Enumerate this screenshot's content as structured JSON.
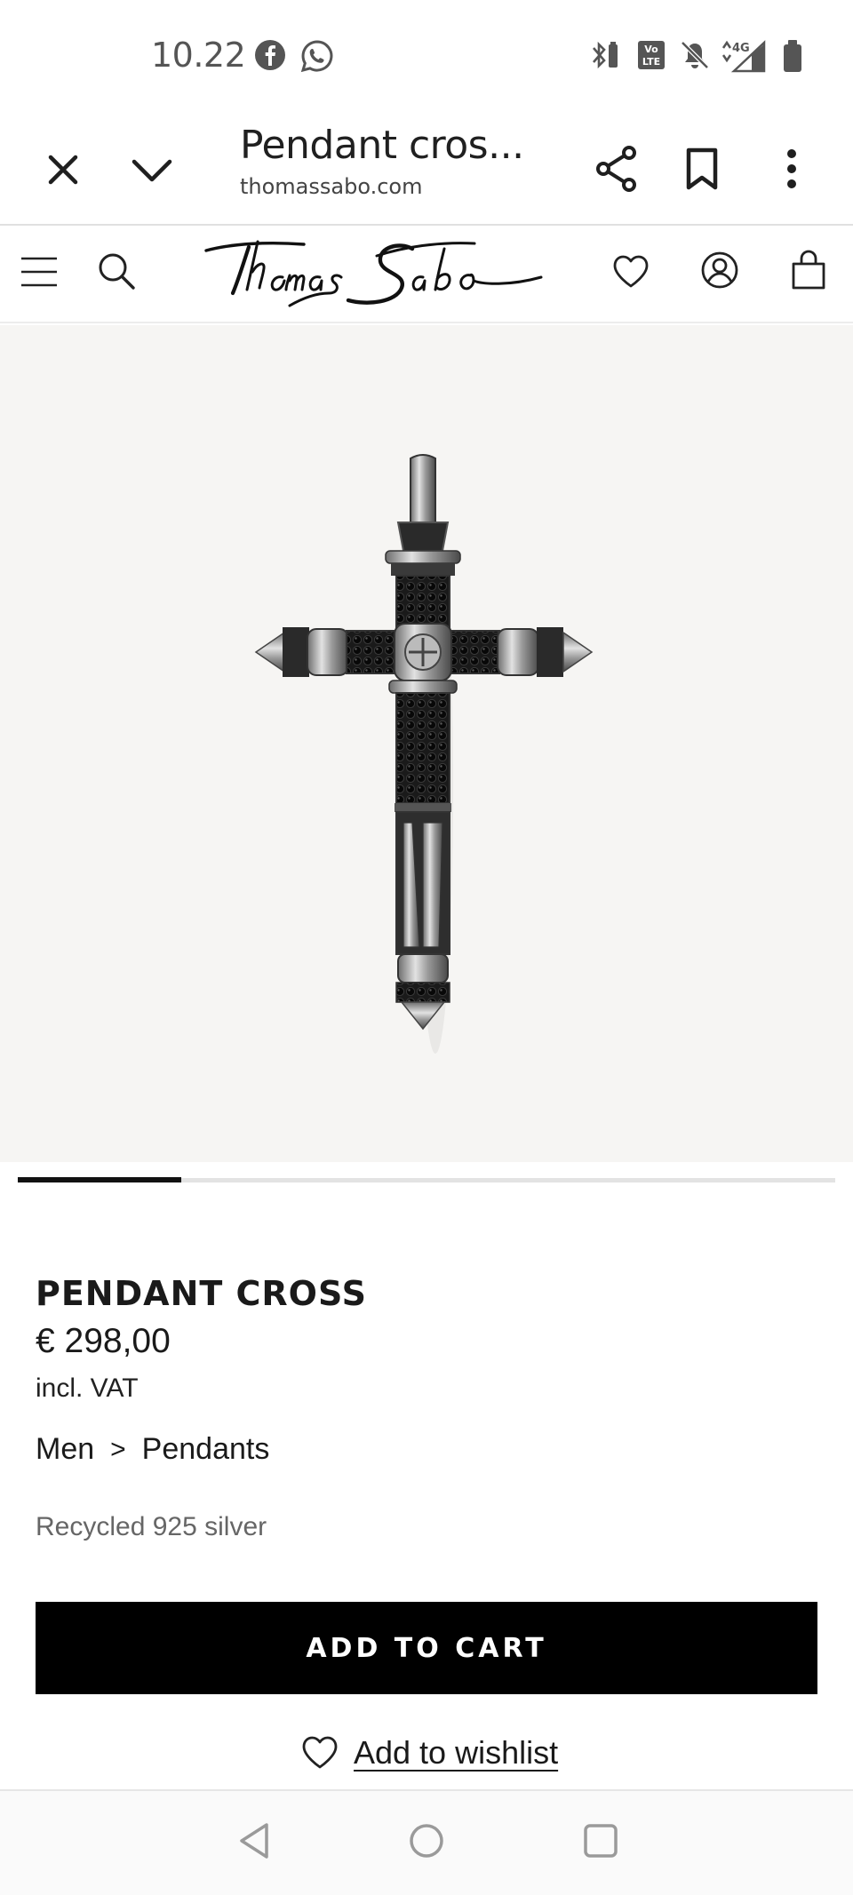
{
  "status_bar": {
    "time": "10.22",
    "left_icons": [
      "facebook-icon",
      "whatsapp-icon"
    ],
    "right_icons": [
      "bluetooth-battery-icon",
      "volte-icon",
      "bell-muted-icon",
      "4g-signal-icon",
      "battery-icon"
    ],
    "network": "4G"
  },
  "browser": {
    "page_title": "Pendant cros...",
    "url": "thomassabo.com"
  },
  "site_header": {
    "logo_text": "Thomas Sabo"
  },
  "gallery": {
    "active_index": 1,
    "progress_fraction": 0.2
  },
  "product": {
    "name": "PENDANT CROSS",
    "price": "€ 298,00",
    "vat": "incl. VAT",
    "breadcrumb": [
      "Men",
      ">",
      "Pendants"
    ],
    "material": "Recycled 925 silver",
    "add_to_cart": "ADD TO CART",
    "wishlist": "Add to wishlist"
  },
  "colors": {
    "accent": "#000000",
    "image_bg": "#f6f5f3"
  }
}
